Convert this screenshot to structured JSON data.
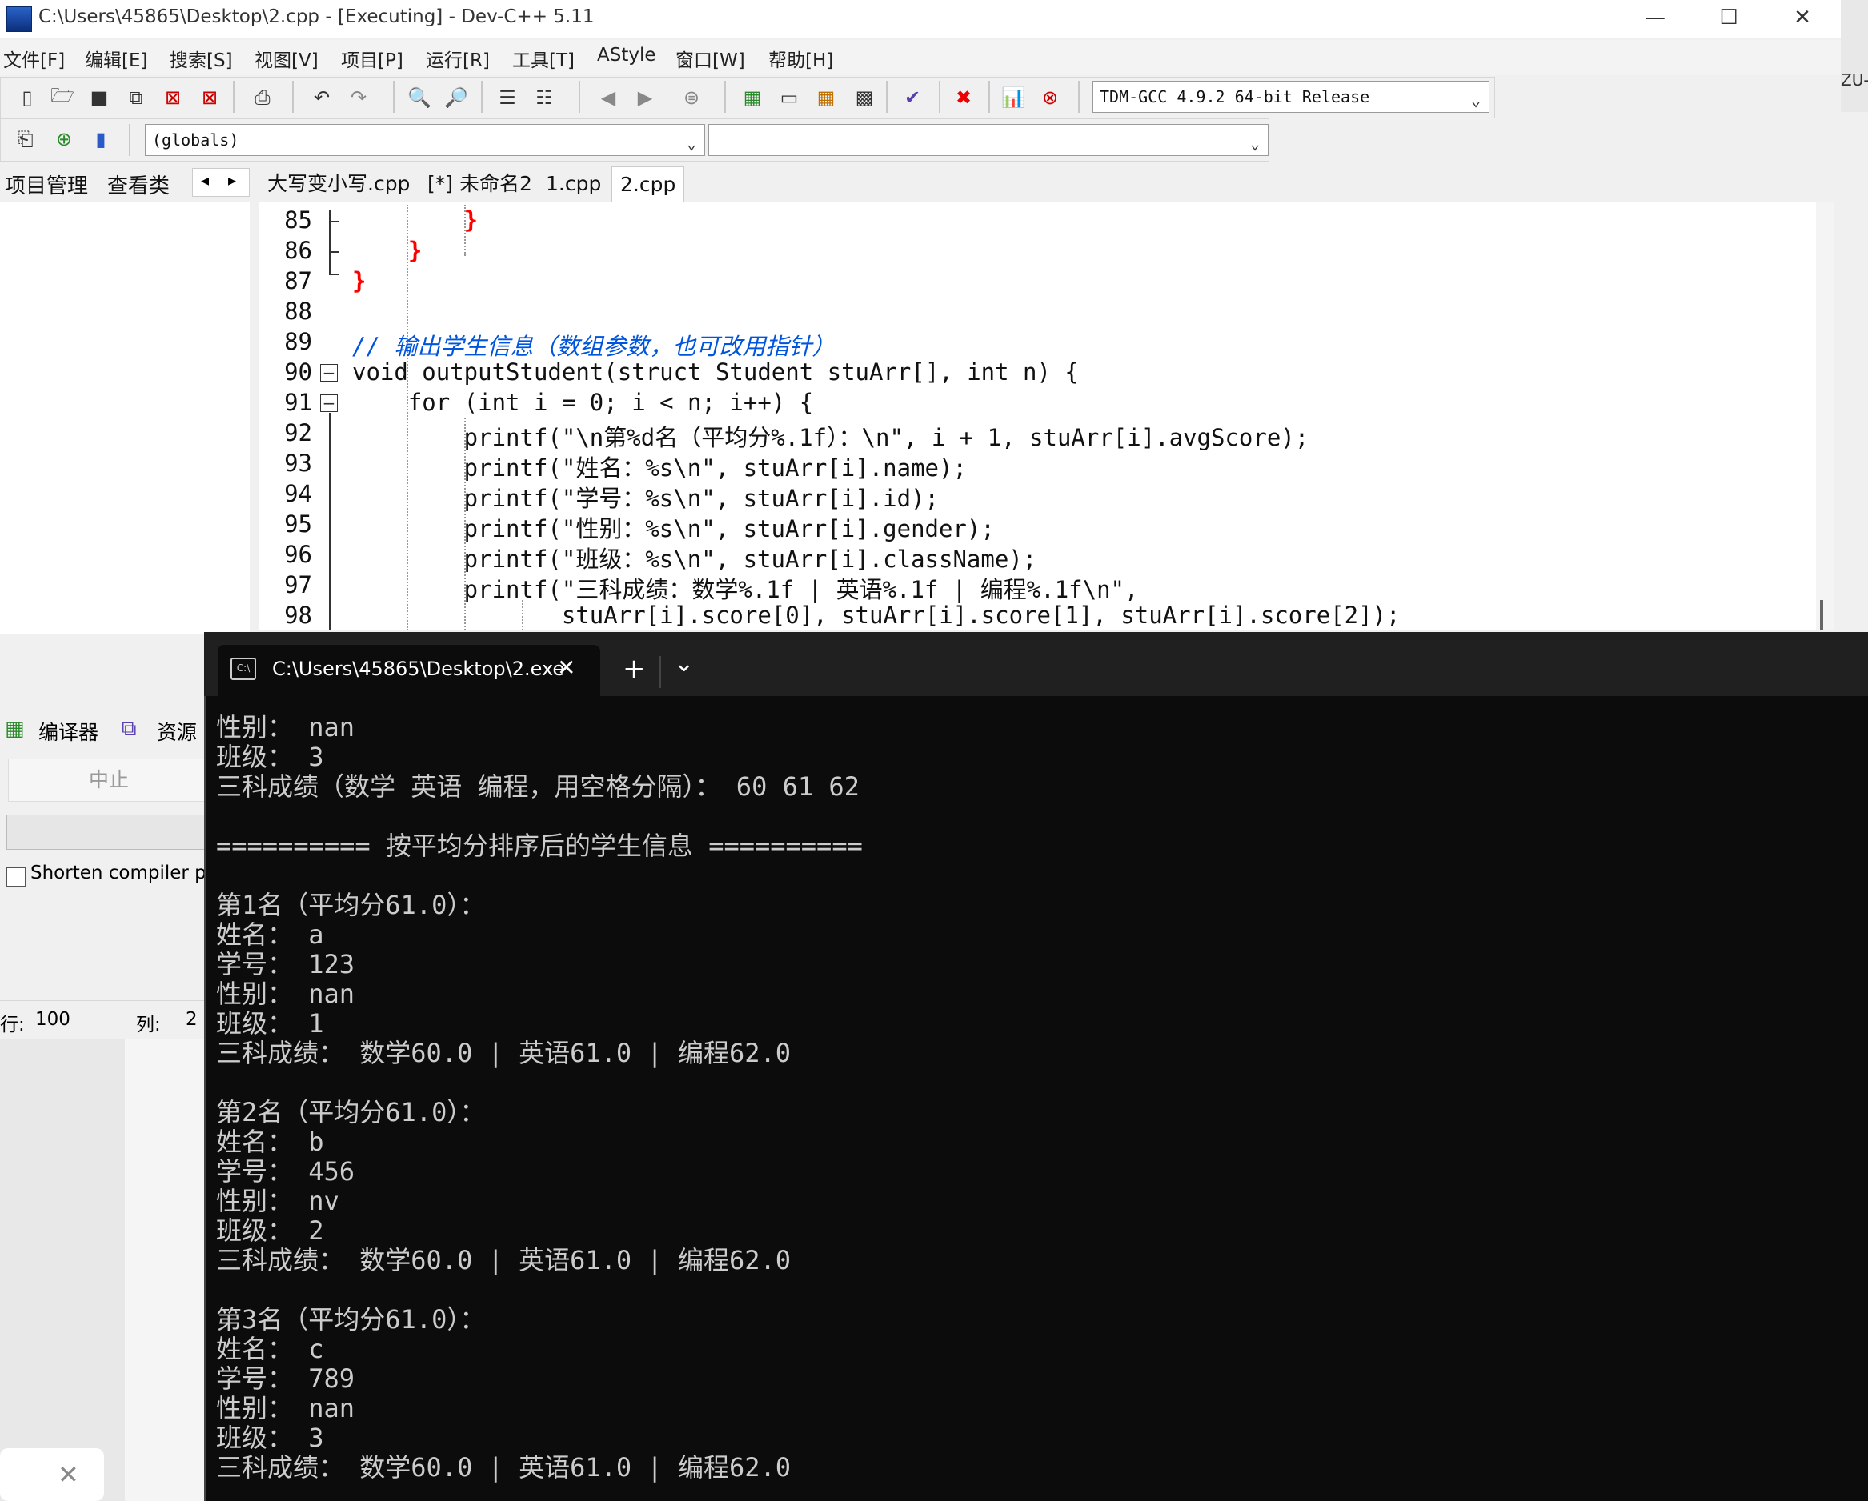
{
  "window": {
    "title": "C:\\Users\\45865\\Desktop\\2.cpp - [Executing] - Dev-C++ 5.11",
    "minimize": "—",
    "maximize": "☐",
    "close": "✕",
    "side_text": "ZU-"
  },
  "menu": [
    "文件[F]",
    "编辑[E]",
    "搜索[S]",
    "视图[V]",
    "项目[P]",
    "运行[R]",
    "工具[T]",
    "AStyle",
    "窗口[W]",
    "帮助[H]"
  ],
  "toolbar": {
    "compiler_select": "TDM-GCC 4.9.2 64-bit Release",
    "scope_select": "(globals)",
    "member_select": ""
  },
  "left_tabs": [
    "项目管理",
    "查看类"
  ],
  "editor_tabs": [
    "大写变小写.cpp",
    "[*] 未命名2",
    "1.cpp",
    "2.cpp"
  ],
  "active_editor_tab": "2.cpp",
  "code": {
    "line_numbers": [
      "85",
      "86",
      "87",
      "88",
      "89",
      "90",
      "91",
      "92",
      "93",
      "94",
      "95",
      "96",
      "97",
      "98"
    ],
    "lines": [
      "        }",
      "    }",
      "}",
      "",
      "// 输出学生信息（数组参数，也可改用指针）",
      "void outputStudent(struct Student stuArr[], int n) {",
      "    for (int i = 0; i < n; i++) {",
      "        printf(\"\\n第%d名（平均分%.1f）：\\n\", i + 1, stuArr[i].avgScore);",
      "        printf(\"姓名：%s\\n\", stuArr[i].name);",
      "        printf(\"学号：%s\\n\", stuArr[i].id);",
      "        printf(\"性别：%s\\n\", stuArr[i].gender);",
      "        printf(\"班级：%s\\n\", stuArr[i].className);",
      "        printf(\"三科成绩：数学%.1f | 英语%.1f | 编程%.1f\\n\",",
      "               stuArr[i].score[0], stuArr[i].score[1], stuArr[i].score[2]);"
    ]
  },
  "compiler_panel": {
    "tabs": [
      "编译器",
      "资源"
    ],
    "stop_button": "中止",
    "shorten_checkbox": "Shorten compiler pa"
  },
  "status": {
    "row_label": "行:",
    "row_value": "100",
    "col_label": "列:",
    "col_value": "2"
  },
  "terminal": {
    "tab_title": "C:\\Users\\45865\\Desktop\\2.exe",
    "new_tab": "+",
    "dropdown": "⌄",
    "lines": [
      "性别： nan",
      "班级： 3",
      "三科成绩（数学 英语 编程，用空格分隔）： 60 61 62",
      "",
      "========== 按平均分排序后的学生信息 ==========",
      "",
      "第1名（平均分61.0）：",
      "姓名： a",
      "学号： 123",
      "性别： nan",
      "班级： 1",
      "三科成绩： 数学60.0 | 英语61.0 | 编程62.0",
      "",
      "第2名（平均分61.0）：",
      "姓名： b",
      "学号： 456",
      "性别： nv",
      "班级： 2",
      "三科成绩： 数学60.0 | 英语61.0 | 编程62.0",
      "",
      "第3名（平均分61.0）：",
      "姓名： c",
      "学号： 789",
      "性别： nan",
      "班级： 3",
      "三科成绩： 数学60.0 | 英语61.0 | 编程62.0"
    ]
  }
}
